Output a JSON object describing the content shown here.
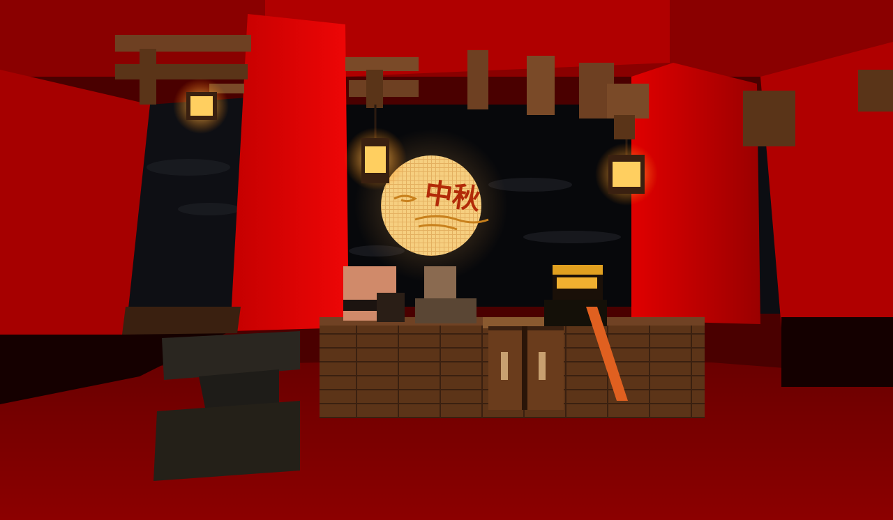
{
  "scene": {
    "moon_text": "中秋",
    "colors": {
      "red_bright": "#e00000",
      "red_mid": "#a80000",
      "red_dark": "#5a0000",
      "sky": "#08090c",
      "moon": "#f4c97a",
      "moon_text": "#b22a08",
      "wood": "#6e4022",
      "wood_dark": "#3a2010",
      "lantern_glow": "#ffb040",
      "floor": "#7a0000"
    },
    "icons": [
      "lantern-icon",
      "moon-icon",
      "anvil-icon",
      "crafting-table-icon",
      "chest-icon",
      "player-character-icon"
    ]
  }
}
